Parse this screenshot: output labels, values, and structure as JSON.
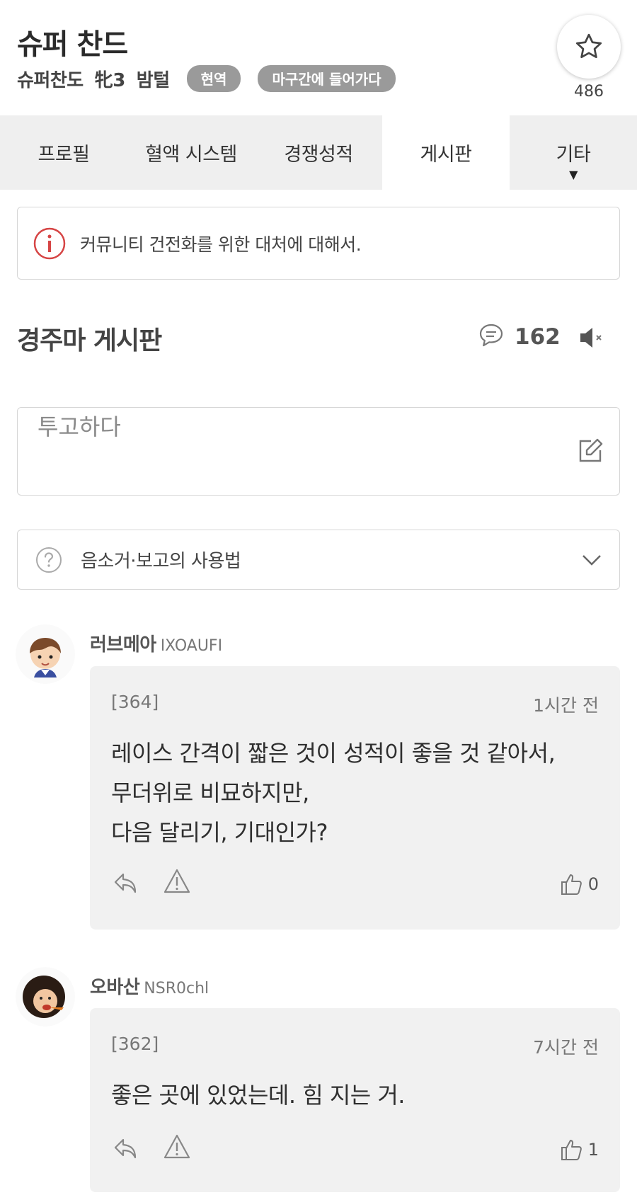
{
  "horse": {
    "name": "슈퍼 찬드",
    "breed_label": "슈퍼찬도",
    "age_label": "牝3",
    "color_label": "밤털",
    "badges": [
      "현역",
      "마구간에 들어가다"
    ],
    "favorite_count": "486"
  },
  "tabs": [
    {
      "label": "프로필",
      "active": false
    },
    {
      "label": "혈액 시스템",
      "active": false
    },
    {
      "label": "경쟁성적",
      "active": false
    },
    {
      "label": "게시판",
      "active": true
    },
    {
      "label": "기타",
      "active": false
    }
  ],
  "notice": {
    "text": "커뮤니티 건전화를 위한 대처에 대해서."
  },
  "board": {
    "title": "경주마 게시판",
    "comment_count": "162"
  },
  "post_box": {
    "placeholder": "투고하다"
  },
  "help": {
    "text": "음소거·보고의 사용법"
  },
  "comments": [
    {
      "user_name": "러브메아",
      "user_id": "IXOAUFI",
      "number": "[364]",
      "time": "1시간 전",
      "lines": [
        "레이스 간격이 짧은 것이 성적이 좋을 것 같아서,",
        "무더위로 비묘하지만,",
        "다음 달리기, 기대인가?"
      ],
      "likes": "0"
    },
    {
      "user_name": "오바산",
      "user_id": "NSR0chl",
      "number": "[362]",
      "time": "7시간 전",
      "lines": [
        "좋은 곳에 있었는데. 힘 지는 거."
      ],
      "likes": "1"
    }
  ],
  "colors": {
    "notice_icon": "#d64545",
    "badge": "#9a9a9a",
    "tab_bar": "#efefef",
    "bubble": "#f1f1f1"
  }
}
